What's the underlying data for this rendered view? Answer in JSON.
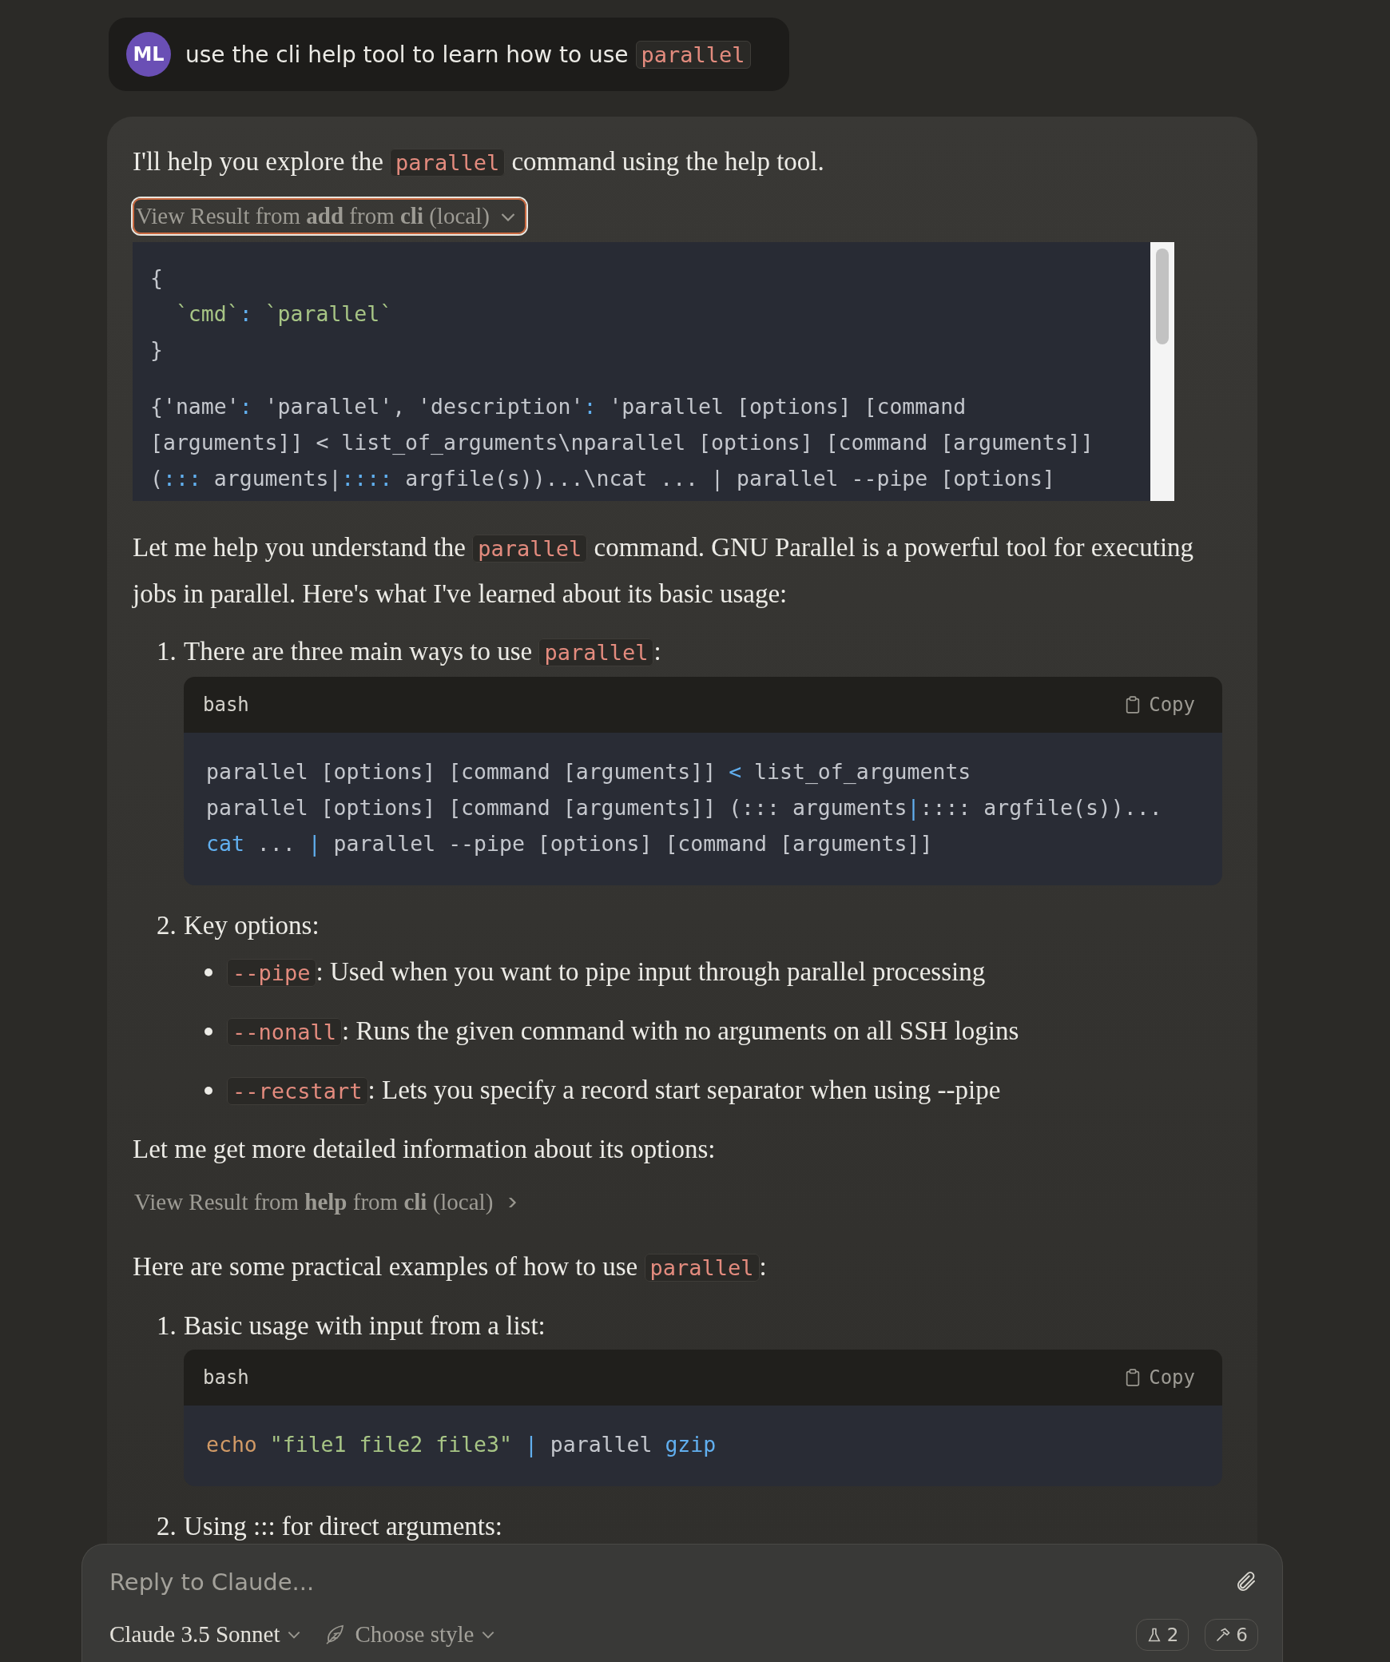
{
  "user_message": {
    "avatar": "ML",
    "segments": [
      {
        "kind": "text",
        "text": "use the cli help tool to learn how to use "
      },
      {
        "kind": "code",
        "text": "parallel"
      }
    ]
  },
  "response": {
    "blocks": [
      {
        "kind": "paragraph",
        "segments": [
          {
            "kind": "text",
            "text": "I'll help you explore the "
          },
          {
            "kind": "code",
            "text": "parallel"
          },
          {
            "kind": "text",
            "text": " command using the help tool."
          }
        ]
      },
      {
        "kind": "tool_result",
        "label": "View Result from **add** from **cli** (local)",
        "expanded": true,
        "focused": true,
        "input_lines": [
          [
            {
              "kind": "plain",
              "text": "{"
            }
          ],
          [
            {
              "kind": "string",
              "text": "  `cmd`"
            },
            {
              "kind": "punct",
              "text": ":"
            },
            {
              "kind": "string",
              "text": " `parallel`"
            }
          ],
          [
            {
              "kind": "plain",
              "text": "}"
            }
          ]
        ],
        "output_lines": [
          [
            {
              "kind": "plain",
              "text": "{'name'"
            },
            {
              "kind": "punct",
              "text": ":"
            },
            {
              "kind": "plain",
              "text": " 'parallel', 'description'"
            },
            {
              "kind": "punct",
              "text": ":"
            },
            {
              "kind": "plain",
              "text": " 'parallel [options] [command"
            }
          ],
          [
            {
              "kind": "plain",
              "text": "[arguments]] < list_of_arguments\\nparallel [options] [command [arguments]]"
            }
          ],
          [
            {
              "kind": "plain",
              "text": "("
            },
            {
              "kind": "punct",
              "text": ":::"
            },
            {
              "kind": "plain",
              "text": " arguments|"
            },
            {
              "kind": "punct",
              "text": "::::"
            },
            {
              "kind": "plain",
              "text": " argfile(s))...\\ncat ... | parallel --pipe [options]"
            }
          ]
        ]
      },
      {
        "kind": "paragraph",
        "segments": [
          {
            "kind": "text",
            "text": "Let me help you understand the "
          },
          {
            "kind": "code",
            "text": "parallel"
          },
          {
            "kind": "text",
            "text": " command. GNU Parallel is a powerful tool for executing jobs in parallel. Here's what I've learned about its basic usage:"
          }
        ]
      },
      {
        "kind": "numbered",
        "number": "1.",
        "segments": [
          {
            "kind": "text",
            "text": "There are three main ways to use "
          },
          {
            "kind": "code",
            "text": "parallel"
          },
          {
            "kind": "text",
            "text": ":"
          }
        ],
        "children": [
          {
            "kind": "code_block",
            "language": "bash",
            "copy": "Copy",
            "lines": [
              [
                {
                  "kind": "plain",
                  "text": "parallel [options] [command [arguments]] "
                },
                {
                  "kind": "keyword",
                  "text": "<"
                },
                {
                  "kind": "plain",
                  "text": " list_of_arguments"
                }
              ],
              [
                {
                  "kind": "plain",
                  "text": "parallel [options] [command [arguments]] (::: arguments"
                },
                {
                  "kind": "keyword",
                  "text": "|"
                },
                {
                  "kind": "plain",
                  "text": ":::: argfile(s))..."
                }
              ],
              [
                {
                  "kind": "keyword",
                  "text": "cat"
                },
                {
                  "kind": "plain",
                  "text": " ... "
                },
                {
                  "kind": "keyword",
                  "text": "|"
                },
                {
                  "kind": "plain",
                  "text": " parallel --pipe [options] [command [arguments]]"
                }
              ]
            ]
          }
        ]
      },
      {
        "kind": "numbered",
        "number": "2.",
        "segments": [
          {
            "kind": "text",
            "text": "Key options:"
          }
        ],
        "children": [
          {
            "kind": "bullet",
            "segments": [
              {
                "kind": "code",
                "text": "--pipe"
              },
              {
                "kind": "text",
                "text": ": Used when you want to pipe input through parallel processing"
              }
            ]
          },
          {
            "kind": "bullet",
            "segments": [
              {
                "kind": "code",
                "text": "--nonall"
              },
              {
                "kind": "text",
                "text": ": Runs the given command with no arguments on all SSH logins"
              }
            ]
          },
          {
            "kind": "bullet",
            "segments": [
              {
                "kind": "code",
                "text": "--recstart"
              },
              {
                "kind": "text",
                "text": ": Lets you specify a record start separator when using --pipe"
              }
            ]
          }
        ]
      },
      {
        "kind": "paragraph",
        "segments": [
          {
            "kind": "text",
            "text": "Let me get more detailed information about its options:"
          }
        ]
      },
      {
        "kind": "tool_result",
        "label": "View Result from **help** from **cli** (local)",
        "expanded": false,
        "focused": false
      },
      {
        "kind": "paragraph",
        "segments": [
          {
            "kind": "text",
            "text": "Here are some practical examples of how to use "
          },
          {
            "kind": "code",
            "text": "parallel"
          },
          {
            "kind": "text",
            "text": ":"
          }
        ]
      },
      {
        "kind": "numbered",
        "number": "1.",
        "segments": [
          {
            "kind": "text",
            "text": "Basic usage with input from a list:"
          }
        ],
        "children": [
          {
            "kind": "code_block",
            "language": "bash",
            "copy": "Copy",
            "lines": [
              [
                {
                  "kind": "builtin",
                  "text": "echo "
                },
                {
                  "kind": "string",
                  "text": "\"file1 file2 file3\""
                },
                {
                  "kind": "keyword",
                  "text": " |"
                },
                {
                  "kind": "plain",
                  "text": " parallel "
                },
                {
                  "kind": "keyword",
                  "text": "gzip"
                }
              ]
            ]
          }
        ]
      },
      {
        "kind": "numbered",
        "number": "2.",
        "segments": [
          {
            "kind": "text",
            "text": "Using ::: for direct arguments:"
          }
        ]
      }
    ]
  },
  "composer": {
    "placeholder": "Reply to Claude...",
    "model": "Claude 3.5 Sonnet",
    "style": "Choose style",
    "badges": [
      {
        "kind": "flask",
        "count": "2"
      },
      {
        "kind": "tools",
        "count": "6"
      }
    ]
  }
}
